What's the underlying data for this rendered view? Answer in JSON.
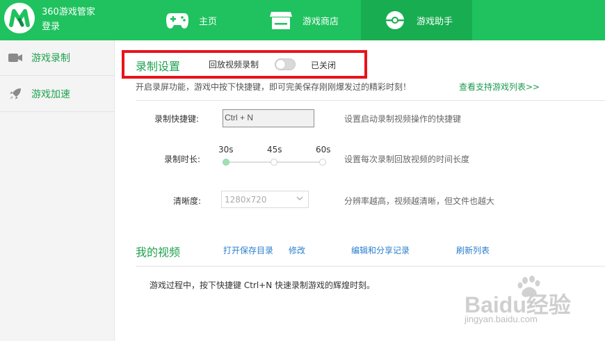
{
  "header": {
    "app_name": "360游戏管家",
    "login_label": "登录",
    "tabs": [
      {
        "label": "主页",
        "icon": "gamepad-icon"
      },
      {
        "label": "游戏商店",
        "icon": "store-icon"
      },
      {
        "label": "游戏助手",
        "icon": "assistant-icon"
      }
    ],
    "active_tab": "游戏助手"
  },
  "sidebar": {
    "items": [
      {
        "label": "游戏录制",
        "icon": "video-camera-icon",
        "active": true
      },
      {
        "label": "游戏加速",
        "icon": "rocket-icon",
        "active": false
      }
    ]
  },
  "record_settings": {
    "title": "录制设置",
    "replay_label": "回放视频录制",
    "toggle_state": "已关闭",
    "toggle_on": false,
    "intro": "开启录屏功能，游戏中按下快捷键，即可完美保存刚刚爆发过的精彩时刻！",
    "support_link": "查看支持游戏列表>>",
    "hotkey_label": "录制快捷键:",
    "hotkey_value": "Ctrl + N",
    "hotkey_desc": "设置启动录制视频操作的快捷键",
    "duration_label": "录制时长:",
    "duration_ticks": [
      "30s",
      "45s",
      "60s"
    ],
    "duration_selected": "30s",
    "duration_desc": "设置每次录制回放视频的时间长度",
    "quality_label": "清晰度:",
    "quality_value": "1280x720",
    "quality_desc": "分辨率越高，视频越清晰，但文件也越大"
  },
  "my_videos": {
    "title": "我的视频",
    "links": [
      "打开保存目录",
      "修改",
      "编辑和分享记录",
      "刷新列表"
    ],
    "hint": "游戏过程中，按下快捷键 Ctrl+N 快速录制游戏的辉煌时刻。"
  },
  "watermark": {
    "brand": "Baidu经验",
    "url": "jingyan.baidu.com"
  },
  "colors": {
    "header_green": "#1fc25e",
    "active_tab_green": "#19ad51",
    "text_green": "#1fa24f",
    "highlight_red": "#e8131b"
  }
}
